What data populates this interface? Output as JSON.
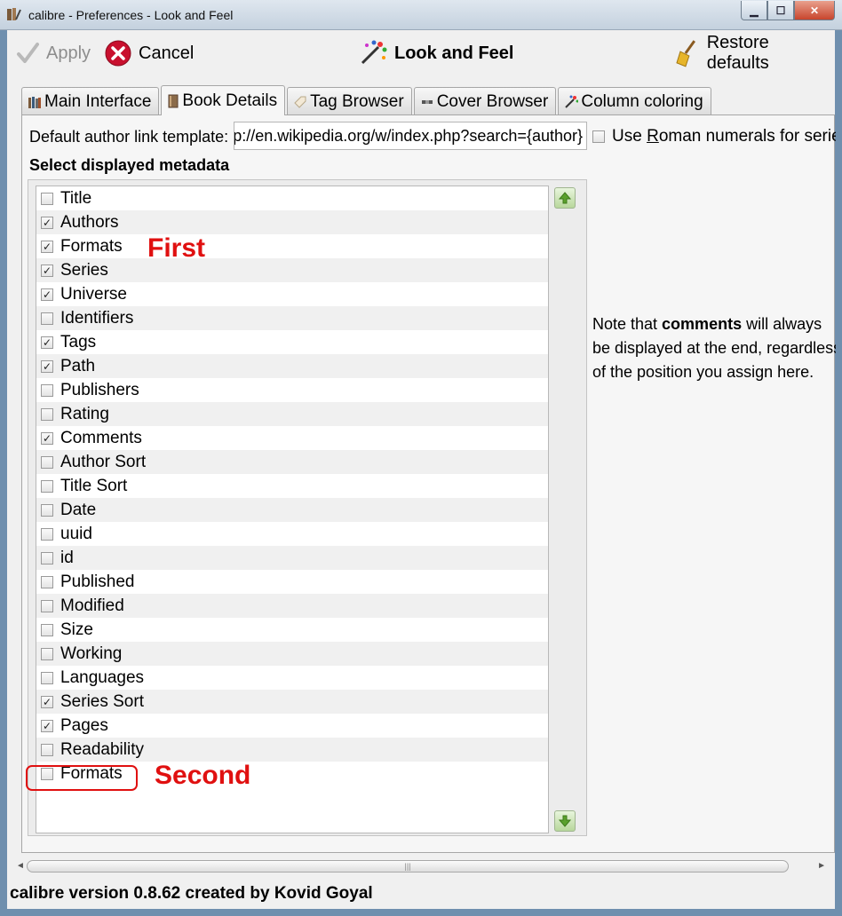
{
  "window": {
    "title": "calibre - Preferences - Look and Feel",
    "minimize_glyph": "▁",
    "maximize_glyph": "☐",
    "close_glyph": "✕"
  },
  "toolbar": {
    "apply_label": "Apply",
    "cancel_label": "Cancel",
    "section_title": "Look and Feel",
    "restore_label": "Restore defaults"
  },
  "tabs": [
    {
      "label": "Main Interface",
      "icon": "books-icon"
    },
    {
      "label": "Book Details",
      "icon": "book-icon",
      "active": true
    },
    {
      "label": "Tag Browser",
      "icon": "tag-icon"
    },
    {
      "label": "Cover Browser",
      "icon": "cover-icon"
    },
    {
      "label": "Column coloring",
      "icon": "palette-icon"
    }
  ],
  "book_details": {
    "author_link_label": "Default author link template:",
    "author_link_value": "http://en.wikipedia.org/w/index.php?search={author}",
    "roman_numerals_label_pre": "Use ",
    "roman_numerals_label_u": "R",
    "roman_numerals_label_post": "oman numerals for series",
    "roman_numerals_checked": false,
    "select_heading": "Select displayed metadata",
    "note_pre": "Note that ",
    "note_bold": "comments",
    "note_line1_post": " will always",
    "note_line2": "be displayed at the end, regardless",
    "note_line3": "of the position you assign here."
  },
  "metadata": [
    {
      "label": "Title",
      "checked": false
    },
    {
      "label": "Authors",
      "checked": true
    },
    {
      "label": "Formats",
      "checked": true
    },
    {
      "label": "Series",
      "checked": true
    },
    {
      "label": "Universe",
      "checked": true
    },
    {
      "label": "Identifiers",
      "checked": false
    },
    {
      "label": "Tags",
      "checked": true
    },
    {
      "label": "Path",
      "checked": true
    },
    {
      "label": "Publishers",
      "checked": false
    },
    {
      "label": "Rating",
      "checked": false
    },
    {
      "label": "Comments",
      "checked": true
    },
    {
      "label": "Author Sort",
      "checked": false
    },
    {
      "label": "Title Sort",
      "checked": false
    },
    {
      "label": "Date",
      "checked": false
    },
    {
      "label": "uuid",
      "checked": false
    },
    {
      "label": "id",
      "checked": false
    },
    {
      "label": "Published",
      "checked": false
    },
    {
      "label": "Modified",
      "checked": false
    },
    {
      "label": "Size",
      "checked": false
    },
    {
      "label": "Working",
      "checked": false
    },
    {
      "label": "Languages",
      "checked": false
    },
    {
      "label": "Series Sort",
      "checked": true
    },
    {
      "label": "Pages",
      "checked": true
    },
    {
      "label": "Readability",
      "checked": false
    },
    {
      "label": "Formats",
      "checked": false
    }
  ],
  "annotations": {
    "first": "First",
    "second": "Second"
  },
  "scrollbar": {
    "left_glyph": "◄",
    "right_glyph": "►",
    "grip": "|||"
  },
  "status": "calibre version 0.8.62 created by Kovid Goyal",
  "colors": {
    "annotation_red": "#e01010",
    "arrow_green": "#5aa02c",
    "cancel_red": "#c8102e"
  }
}
